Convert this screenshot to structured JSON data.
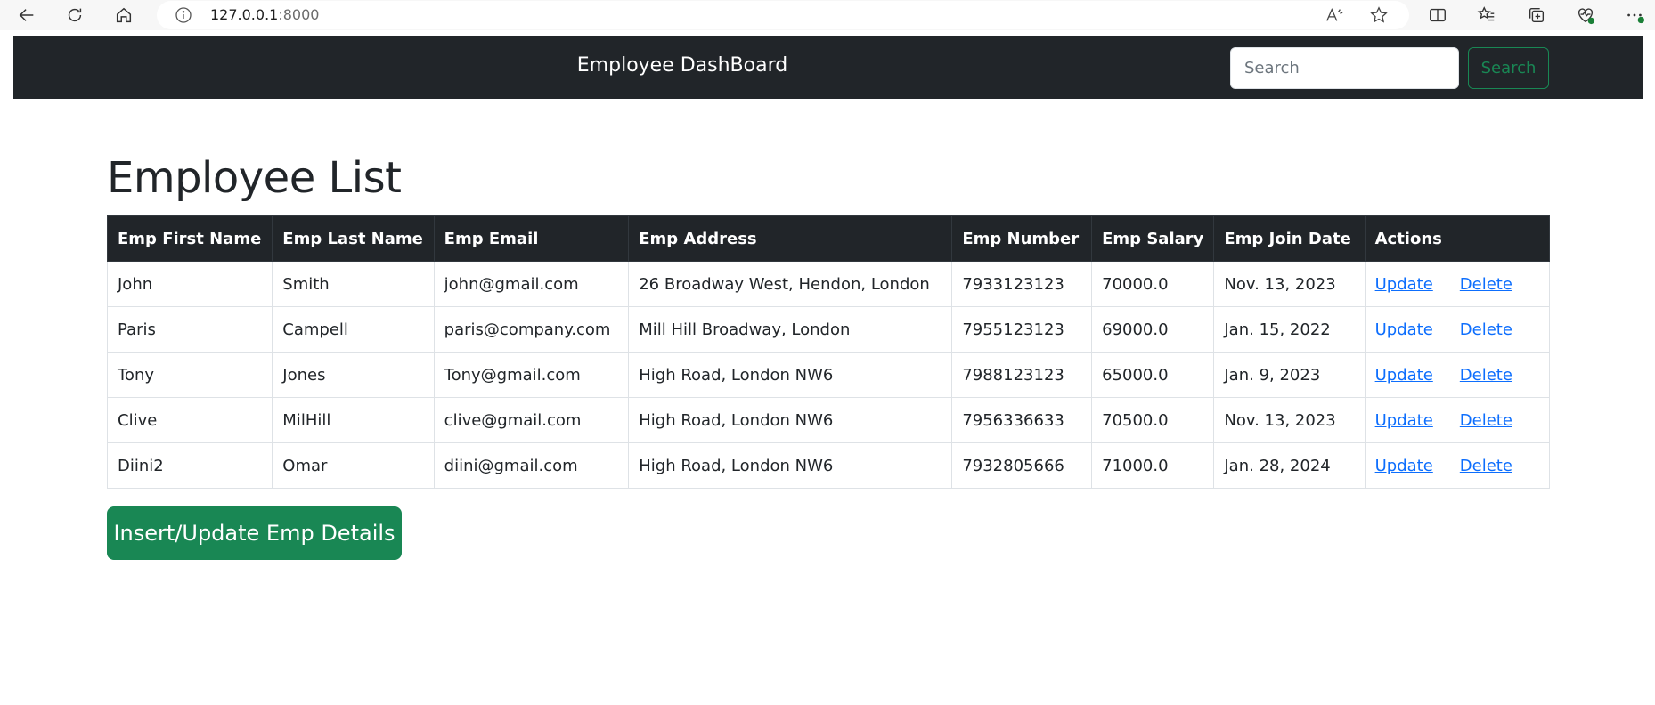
{
  "browser": {
    "url_host": "127.0.0.1",
    "url_port": ":8000",
    "icons": [
      "back-icon",
      "reload-icon",
      "home-icon",
      "info-icon",
      "read-aloud-icon",
      "favorite-star-icon",
      "split-screen-icon",
      "favorites-icon",
      "collections-icon",
      "browser-essentials-icon",
      "more-icon"
    ]
  },
  "navbar": {
    "brand": "Employee DashBoard",
    "search_placeholder": "Search",
    "search_button": "Search"
  },
  "page": {
    "title": "Employee List"
  },
  "table": {
    "headers": [
      "Emp First Name",
      "Emp Last Name",
      "Emp Email",
      "Emp Address",
      "Emp Number",
      "Emp Salary",
      "Emp Join Date",
      "Actions"
    ],
    "rows": [
      {
        "first": "John",
        "last": "Smith",
        "email": "john@gmail.com",
        "address": "26 Broadway West, Hendon, London",
        "number": "7933123123",
        "salary": "70000.0",
        "join": "Nov. 13, 2023"
      },
      {
        "first": "Paris",
        "last": "Campell",
        "email": "paris@company.com",
        "address": "Mill Hill Broadway, London",
        "number": "7955123123",
        "salary": "69000.0",
        "join": "Jan. 15, 2022"
      },
      {
        "first": "Tony",
        "last": "Jones",
        "email": "Tony@gmail.com",
        "address": "High Road, London NW6",
        "number": "7988123123",
        "salary": "65000.0",
        "join": "Jan. 9, 2023"
      },
      {
        "first": "Clive",
        "last": "MilHill",
        "email": "clive@gmail.com",
        "address": "High Road, London NW6",
        "number": "7956336633",
        "salary": "70500.0",
        "join": "Nov. 13, 2023"
      },
      {
        "first": "Diini2",
        "last": "Omar",
        "email": "diini@gmail.com",
        "address": "High Road, London NW6",
        "number": "7932805666",
        "salary": "71000.0",
        "join": "Jan. 28, 2024"
      }
    ],
    "update_label": "Update",
    "delete_label": "Delete"
  },
  "insert_button": "Insert/Update Emp Details",
  "colors": {
    "navbar": "#212529",
    "success": "#198754",
    "link": "#0d6efd"
  }
}
